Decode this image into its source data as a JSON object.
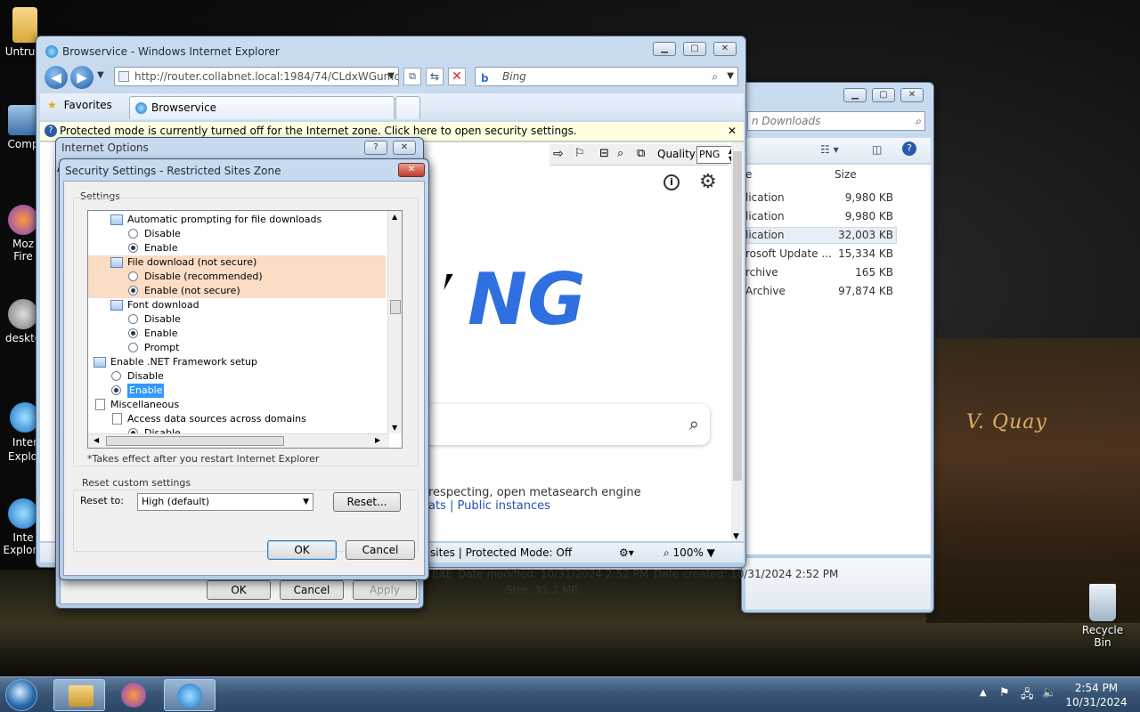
{
  "desktop": {
    "icons": [
      {
        "label": "Untrust"
      },
      {
        "label": "Comp"
      },
      {
        "label": "Moz\nFire"
      },
      {
        "label": "deskto"
      },
      {
        "label": "Inter\nExplor"
      },
      {
        "label": "Inte\nExplore"
      }
    ],
    "recycle_bin": "Recycle Bin",
    "sign_text": "V.  Quay"
  },
  "explorer": {
    "search_placeholder": "n Downloads",
    "col_size": "Size",
    "col_name_partial": "e",
    "rows": [
      {
        "type": "lication",
        "size": "9,980 KB"
      },
      {
        "type": "lication",
        "size": "9,980 KB"
      },
      {
        "type": "lication",
        "size": "32,003 KB"
      },
      {
        "type": "rosoft Update ...",
        "size": "15,334 KB"
      },
      {
        "type": "rchive",
        "size": "165 KB"
      },
      {
        "type": "Archive",
        "size": "97,874 KB"
      }
    ],
    "details": {
      "file_type": "EXE",
      "date_modified": "Date modified: 10/31/2024 2:52 PM",
      "date_created": "Date created: 10/31/2024 2:52 PM",
      "size": "Size: 31.2 MB"
    }
  },
  "ie": {
    "window_title": "Browservice - Windows Internet Explorer",
    "address": "http://router.collabnet.local:1984/74/CLdxWGumcsR",
    "search_text": "Bing",
    "favorites": "Favorites",
    "tab_label": "Browservice",
    "infobar": "Protected mode is currently turned off for the Internet zone.  Click here to open security settings.",
    "quality_label": "Quality",
    "quality_value": "PNG",
    "page_heading_partial": "NG",
    "page_text_1": "respecting, open metasearch engine",
    "page_text_2": "ats | Public instances",
    "status_zone": "sites | Protected Mode: Off",
    "zoom": "100%"
  },
  "internet_options": {
    "title": "Internet Options",
    "tab_partial": "Ac",
    "ok": "OK",
    "cancel": "Cancel",
    "apply": "Apply"
  },
  "security_settings": {
    "title": "Security Settings - Restricted Sites Zone",
    "settings_label": "Settings",
    "tree": [
      {
        "kind": "setting",
        "label": "Automatic prompting for file downloads",
        "indent": 1
      },
      {
        "kind": "radio",
        "label": "Disable",
        "indent": 2,
        "checked": false
      },
      {
        "kind": "radio",
        "label": "Enable",
        "indent": 2,
        "checked": true
      },
      {
        "kind": "setting",
        "label": "File download (not secure)",
        "indent": 1,
        "highlight": true
      },
      {
        "kind": "radio",
        "label": "Disable (recommended)",
        "indent": 2,
        "checked": false,
        "highlight": true
      },
      {
        "kind": "radio",
        "label": "Enable (not secure)",
        "indent": 2,
        "checked": true,
        "highlight": true
      },
      {
        "kind": "setting",
        "label": "Font download",
        "indent": 1
      },
      {
        "kind": "radio",
        "label": "Disable",
        "indent": 2,
        "checked": false
      },
      {
        "kind": "radio",
        "label": "Enable",
        "indent": 2,
        "checked": true
      },
      {
        "kind": "radio",
        "label": "Prompt",
        "indent": 2,
        "checked": false
      },
      {
        "kind": "setting",
        "label": "Enable .NET Framework setup",
        "indent": 0
      },
      {
        "kind": "radio",
        "label": "Disable",
        "indent": 1,
        "checked": false
      },
      {
        "kind": "radio",
        "label": "Enable",
        "indent": 1,
        "checked": true,
        "selected": true
      },
      {
        "kind": "doc",
        "label": "Miscellaneous",
        "indent": 0
      },
      {
        "kind": "doc",
        "label": "Access data sources across domains",
        "indent": 1
      },
      {
        "kind": "radio",
        "label": "Disable",
        "indent": 2,
        "checked": true
      }
    ],
    "restart_note": "*Takes effect after you restart Internet Explorer",
    "reset_group": "Reset custom settings",
    "reset_to_label": "Reset to:",
    "reset_to_value": "High (default)",
    "reset_button": "Reset...",
    "ok": "OK",
    "cancel": "Cancel"
  },
  "taskbar": {
    "time": "2:54 PM",
    "date": "10/31/2024"
  },
  "colors": {
    "highlight_row": "#fbdcc4",
    "selection": "#3399ff",
    "bing_blue": "#2f6fe0"
  }
}
